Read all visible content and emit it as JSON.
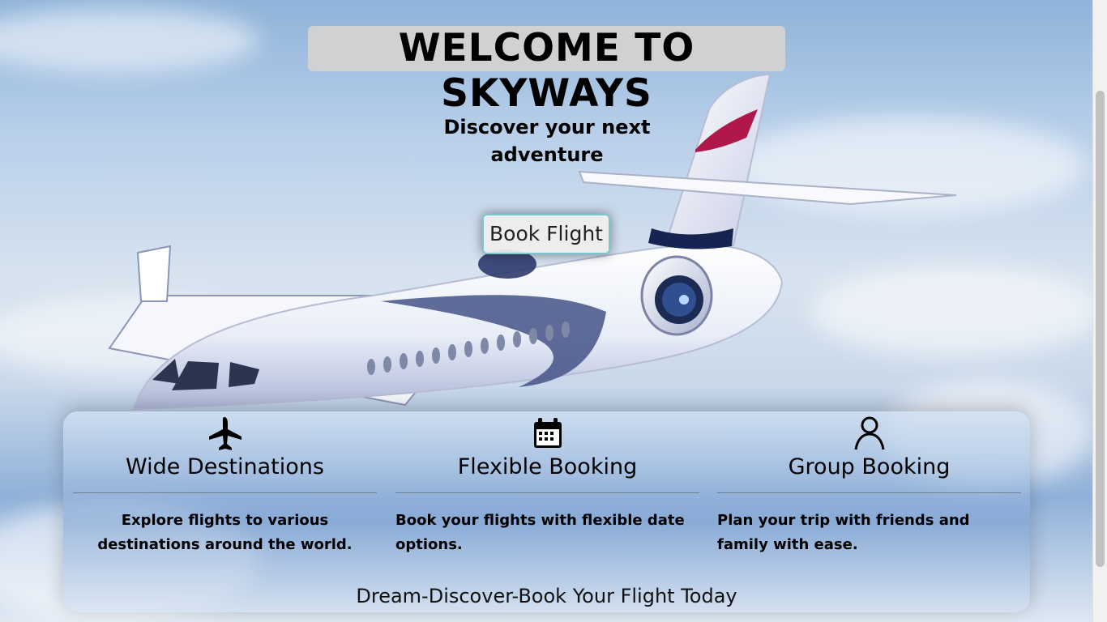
{
  "hero": {
    "title": "WELCOME TO SKYWAYS",
    "subtitle": "Discover your next adventure",
    "button": "Book Flight"
  },
  "features": [
    {
      "icon": "airplane-icon",
      "title": "Wide Destinations",
      "text": "Explore flights to various destinations around the world."
    },
    {
      "icon": "calendar-icon",
      "title": "Flexible Booking",
      "text": "Book your flights with flexible date options."
    },
    {
      "icon": "user-icon",
      "title": "Group Booking",
      "text": "Plan your trip with friends and family with ease."
    }
  ],
  "tagline": "Dream-Discover-Book Your Flight Today",
  "colors": {
    "sky": "#b9d0ea",
    "button_border": "#7ec4cc",
    "title_bg": "#d2d2d2"
  }
}
